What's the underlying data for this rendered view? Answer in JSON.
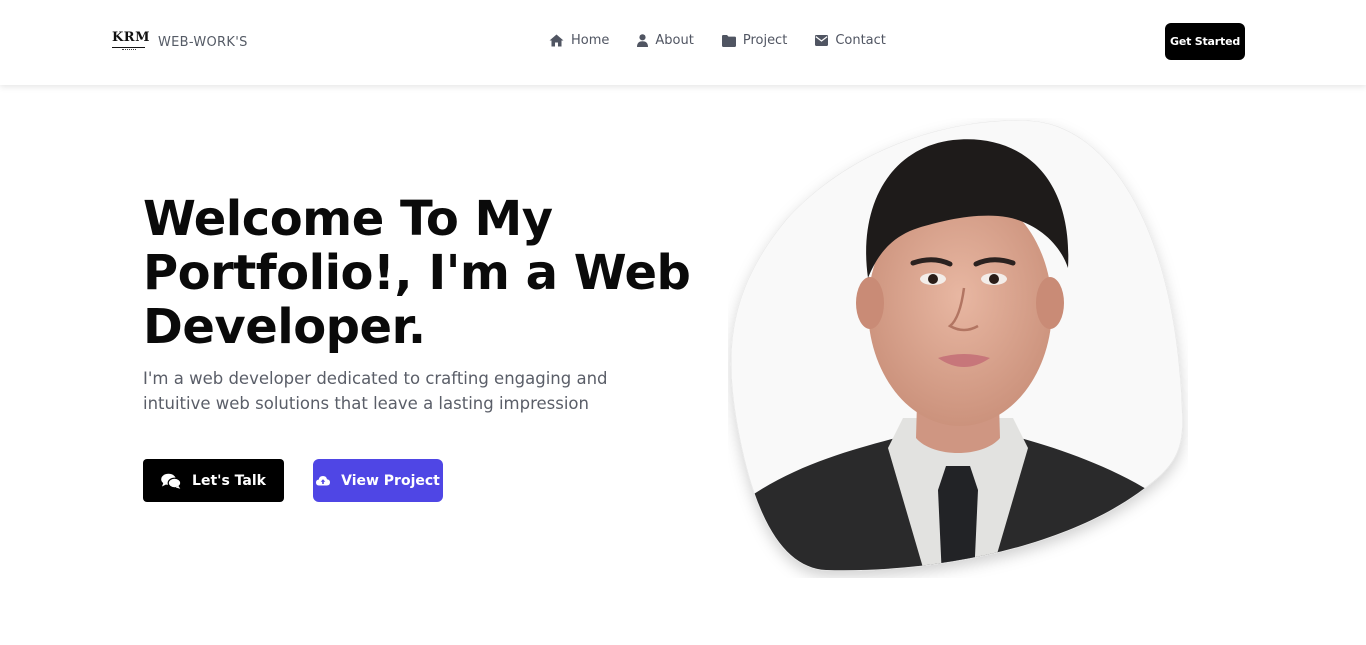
{
  "header": {
    "logo_text": "KRM",
    "brand_name": "WEB-WORK'S",
    "nav": [
      {
        "label": "Home",
        "icon": "home-icon"
      },
      {
        "label": "About",
        "icon": "user-icon"
      },
      {
        "label": "Project",
        "icon": "folder-icon"
      },
      {
        "label": "Contact",
        "icon": "envelope-icon"
      }
    ],
    "cta_label": "Get Started"
  },
  "hero": {
    "title": "Welcome To My Portfolio!, I'm a Web Developer.",
    "subtitle": "I'm a web developer dedicated to crafting engaging and intuitive web solutions that leave a lasting impression",
    "buttons": [
      {
        "label": "Let's Talk",
        "icon": "chat-bubbles-icon"
      },
      {
        "label": "View Project",
        "icon": "cloud-upload-icon"
      }
    ],
    "portrait": {
      "description_icon": "profile-photo"
    }
  },
  "colors": {
    "primary_button": "#000000",
    "accent_button": "#4f46e5",
    "nav_text": "#505562",
    "title_text": "#0a0a0a"
  }
}
